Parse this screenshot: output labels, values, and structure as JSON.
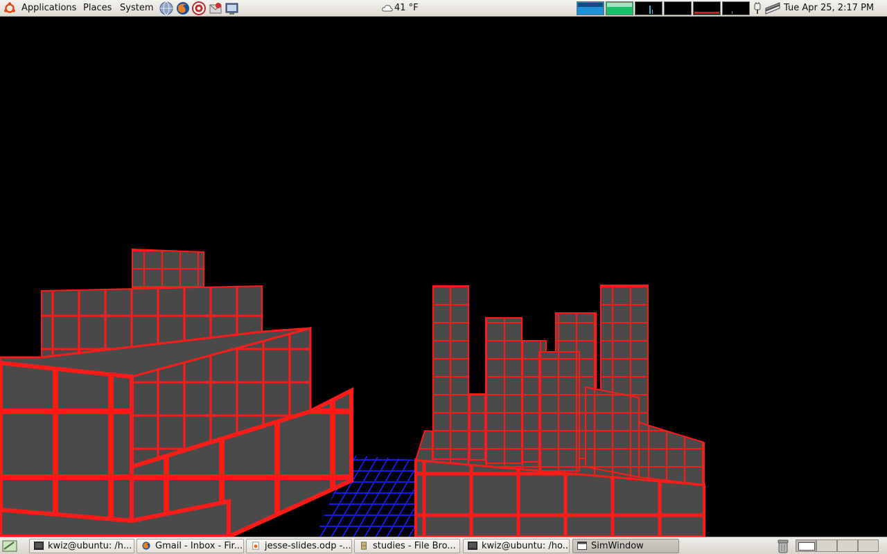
{
  "top_panel": {
    "menus": {
      "applications": "Applications",
      "places": "Places",
      "system": "System"
    },
    "launchers": [
      "network-icon",
      "firefox-icon",
      "help-icon",
      "evolution-icon",
      "screenshot-icon"
    ],
    "weather": {
      "icon": "cloud-icon",
      "temperature": "41 °F"
    },
    "system_monitor": {
      "cpu_color": "#1f8fd6",
      "memory_color": "#18c06a",
      "net_color": "#3ab8c8",
      "swap_color": "#d02020"
    },
    "clock": "Tue Apr 25,  2:17 PM"
  },
  "scene": {
    "title": "SimWindow",
    "block_color": "#4a4a4a",
    "grid_color": "#ff1a1a",
    "floor_color": "#1a1aff"
  },
  "taskbar": {
    "items": [
      {
        "label": "kwiz@ubuntu: /h...",
        "icon": "terminal-icon",
        "active": false
      },
      {
        "label": "Gmail - Inbox - Fir...",
        "icon": "firefox-icon",
        "active": false
      },
      {
        "label": "jesse-slides.odp -...",
        "icon": "presentation-icon",
        "active": false
      },
      {
        "label": "studies - File Bro...",
        "icon": "file-cabinet-icon",
        "active": false
      },
      {
        "label": "kwiz@ubuntu: /ho...",
        "icon": "terminal-icon",
        "active": false
      },
      {
        "label": "SimWindow",
        "icon": "window-icon",
        "active": true
      }
    ]
  }
}
